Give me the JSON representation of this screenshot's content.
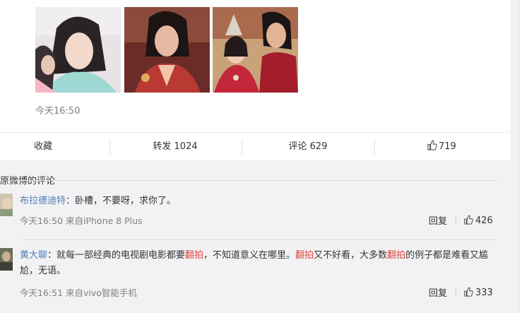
{
  "post": {
    "timestamp": "今天16:50"
  },
  "actions": {
    "favorite": "收藏",
    "repost": "转发 1024",
    "comment": "评论 629",
    "like_count": "719"
  },
  "comments": {
    "section_title": "原微博的评论",
    "items": [
      {
        "user": "布拉德迪特",
        "text": "：卧槽，不要呀，求你了。",
        "meta": "今天16:50 来自iPhone 8 Plus",
        "reply": "回复",
        "likes": "426"
      },
      {
        "user": "黄大聊",
        "text_parts": [
          "：就每一部经典的电视剧电影都要",
          "翻拍",
          "，不知道意义在哪里。",
          "翻拍",
          "又不好看，大多数",
          "翻拍",
          "的例子都是难看又尴",
          "尬，无语。"
        ],
        "meta": "今天16:51 来自vivo智能手机",
        "reply": "回复",
        "likes": "333"
      }
    ]
  },
  "colors": {
    "username": "#507daf",
    "keyword": "#e0443d",
    "meta": "#808080"
  },
  "icons": [
    "thumbs-up-icon"
  ]
}
